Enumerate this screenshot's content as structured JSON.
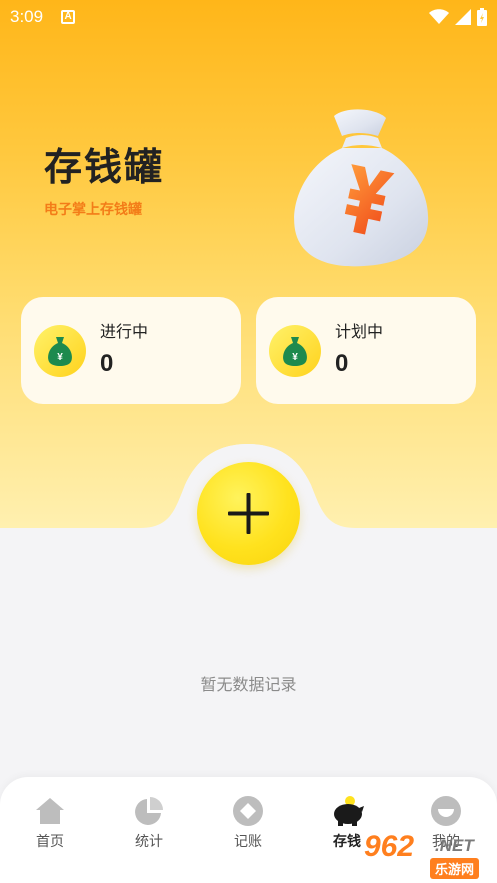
{
  "status_bar": {
    "time": "3:09",
    "notification_icon": "a-icon"
  },
  "header": {
    "title": "存钱罐",
    "subtitle": "电子掌上存钱罐",
    "illustration": "money-bag-yuan"
  },
  "cards": [
    {
      "label": "进行中",
      "value": "0",
      "icon": "money-bag-icon"
    },
    {
      "label": "计划中",
      "value": "0",
      "icon": "money-bag-icon"
    }
  ],
  "add_button": {
    "icon": "plus-icon"
  },
  "empty_state": {
    "text": "暂无数据记录"
  },
  "bottom_nav": {
    "items": [
      {
        "label": "首页",
        "icon": "home-icon"
      },
      {
        "label": "统计",
        "icon": "pie-chart-icon"
      },
      {
        "label": "记账",
        "icon": "diamond-icon"
      },
      {
        "label": "存钱",
        "icon": "piggy-bank-icon",
        "active": true
      },
      {
        "label": "我的",
        "icon": "profile-icon"
      }
    ]
  },
  "watermark": {
    "brand": "962",
    "domain": ".NET",
    "text": "乐游网"
  },
  "colors": {
    "accent_yellow": "#ffe21e",
    "gradient_top": "#ffb619",
    "subtitle_orange": "#f37c18",
    "card_bg": "#fffaed",
    "page_bg": "#f4f4f6"
  }
}
